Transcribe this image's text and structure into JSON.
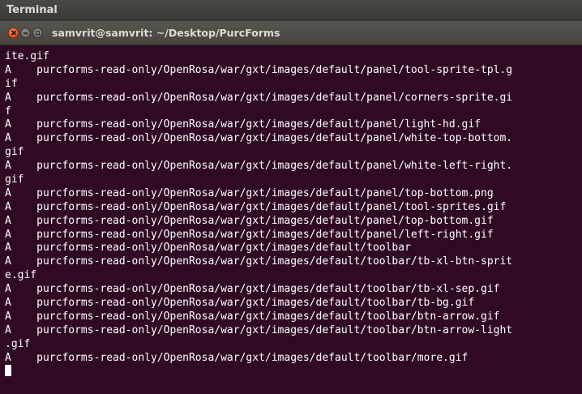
{
  "top_panel": {
    "app_name": "Terminal"
  },
  "window": {
    "title": "samvrit@samvrit: ~/Desktop/PurcForms",
    "buttons": [
      "close-icon",
      "minimize-icon",
      "maximize-icon"
    ],
    "colors": {
      "background": "#300a24",
      "text": "#ffffff",
      "close": "#df4a16"
    }
  },
  "terminal": {
    "lines": [
      "ite.gif",
      "A    purcforms-read-only/OpenRosa/war/gxt/images/default/panel/tool-sprite-tpl.g",
      "if",
      "A    purcforms-read-only/OpenRosa/war/gxt/images/default/panel/corners-sprite.gi",
      "f",
      "A    purcforms-read-only/OpenRosa/war/gxt/images/default/panel/light-hd.gif",
      "A    purcforms-read-only/OpenRosa/war/gxt/images/default/panel/white-top-bottom.",
      "gif",
      "A    purcforms-read-only/OpenRosa/war/gxt/images/default/panel/white-left-right.",
      "gif",
      "A    purcforms-read-only/OpenRosa/war/gxt/images/default/panel/top-bottom.png",
      "A    purcforms-read-only/OpenRosa/war/gxt/images/default/panel/tool-sprites.gif",
      "A    purcforms-read-only/OpenRosa/war/gxt/images/default/panel/top-bottom.gif",
      "A    purcforms-read-only/OpenRosa/war/gxt/images/default/panel/left-right.gif",
      "A    purcforms-read-only/OpenRosa/war/gxt/images/default/toolbar",
      "A    purcforms-read-only/OpenRosa/war/gxt/images/default/toolbar/tb-xl-btn-sprit",
      "e.gif",
      "A    purcforms-read-only/OpenRosa/war/gxt/images/default/toolbar/tb-xl-sep.gif",
      "A    purcforms-read-only/OpenRosa/war/gxt/images/default/toolbar/tb-bg.gif",
      "A    purcforms-read-only/OpenRosa/war/gxt/images/default/toolbar/btn-arrow.gif",
      "A    purcforms-read-only/OpenRosa/war/gxt/images/default/toolbar/btn-arrow-light",
      ".gif",
      "A    purcforms-read-only/OpenRosa/war/gxt/images/default/toolbar/more.gif"
    ]
  }
}
